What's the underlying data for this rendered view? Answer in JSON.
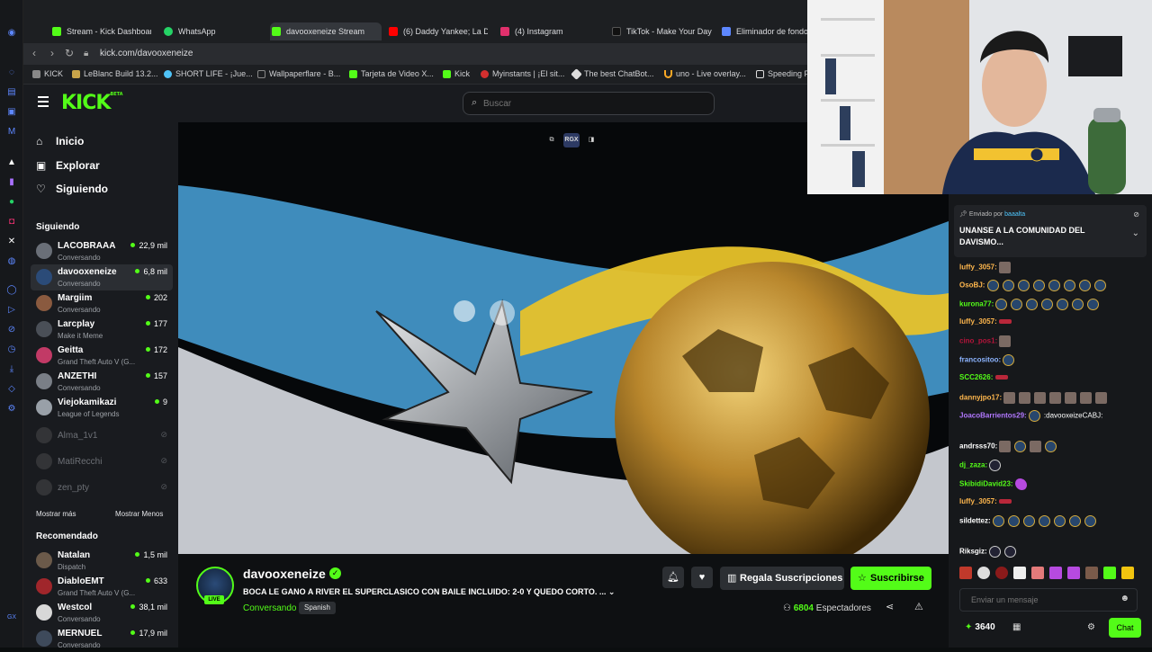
{
  "browser": {
    "tabs": [
      {
        "label": "Stream - Kick Dashboard",
        "color": "#53fc18"
      },
      {
        "label": "WhatsApp",
        "color": "#25d366"
      },
      {
        "label": "davooxeneize Stream",
        "color": "#53fc18",
        "active": true
      },
      {
        "label": "(6) Daddy Yankee; La D",
        "color": "#ff0000"
      },
      {
        "label": "(4) Instagram",
        "color": "#e1306c"
      },
      {
        "label": "TikTok - Make Your Day",
        "color": "#111111"
      },
      {
        "label": "Eliminador de fondo",
        "color": "#5d87ff"
      }
    ],
    "url": "kick.com/davooxeneize",
    "bookmarks": [
      {
        "label": "KICK",
        "color": "#888"
      },
      {
        "label": "LeBlanc Build 13.2...",
        "color": "#c8a44a"
      },
      {
        "label": "SHORT LIFE - ¡Jue...",
        "color": "#4fc3f7"
      },
      {
        "label": "Wallpaperflare - B...",
        "color": "#888"
      },
      {
        "label": "Tarjeta de Video X...",
        "color": "#53fc18"
      },
      {
        "label": "Kick",
        "color": "#53fc18"
      },
      {
        "label": "Myinstants | ¡El sit...",
        "color": "#d32f2f"
      },
      {
        "label": "The best ChatBot...",
        "color": "#ddd"
      },
      {
        "label": "uno - Live overlay...",
        "color": "#f9a825"
      },
      {
        "label": "Speeding F",
        "color": "#ddd"
      }
    ]
  },
  "header": {
    "logo": "KICK",
    "logo_beta": "BETA",
    "search_placeholder": "Buscar"
  },
  "sidebar": {
    "nav": [
      {
        "label": "Inicio",
        "icon": "home-icon"
      },
      {
        "label": "Explorar",
        "icon": "compass-icon"
      },
      {
        "label": "Siguiendo",
        "icon": "heart-icon"
      }
    ],
    "following_title": "Siguiendo",
    "following": [
      {
        "name": "LACOBRAAA",
        "sub": "Conversando",
        "viewers": "22,9 mil"
      },
      {
        "name": "davooxeneize",
        "sub": "Conversando",
        "viewers": "6,8 mil",
        "selected": true
      },
      {
        "name": "Margiim",
        "sub": "Conversando",
        "viewers": "202"
      },
      {
        "name": "Larcplay",
        "sub": "Make it Meme",
        "viewers": "177"
      },
      {
        "name": "Geitta",
        "sub": "Grand Theft Auto V (G...",
        "viewers": "172"
      },
      {
        "name": "ANZETHI",
        "sub": "Conversando",
        "viewers": "157"
      },
      {
        "name": "Viejokamikazi",
        "sub": "League of Legends",
        "viewers": "9"
      }
    ],
    "offline": [
      {
        "name": "Alma_1v1"
      },
      {
        "name": "MatiRecchi"
      },
      {
        "name": "zen_pty"
      }
    ],
    "show_more": "Mostrar más",
    "show_less": "Mostrar Menos",
    "recommended_title": "Recomendado",
    "recommended": [
      {
        "name": "Natalan",
        "sub": "Dispatch",
        "viewers": "1,5 mil"
      },
      {
        "name": "DiabloEMT",
        "sub": "Grand Theft Auto V (G...",
        "viewers": "633"
      },
      {
        "name": "Westcol",
        "sub": "Conversando",
        "viewers": "38,1 mil"
      },
      {
        "name": "MERNUEL",
        "sub": "Conversando",
        "viewers": "17,9 mil"
      }
    ]
  },
  "player": {
    "tools": [
      "RGX"
    ]
  },
  "stream": {
    "name": "davooxeneize",
    "live_badge": "LIVE",
    "title": "BOCA LE GANO A RIVER EL SUPERCLASICO CON BAILE INCLUIDO: 2-0 Y QUEDO CORTO. ...",
    "category": "Conversando",
    "language": "Spanish",
    "gift_label": "Regala Suscripciones",
    "subscribe_label": "Suscribirse",
    "viewer_count": "6804",
    "viewer_label": "Espectadores"
  },
  "chat": {
    "pinned_by_prefix": "Enviado por",
    "pinned_by": "baaalta",
    "pinned_message": "UNANSE A LA COMUNIDAD DEL DAVISMO...",
    "messages": [
      {
        "user": "luffy_3057:",
        "color": "#ffb74d",
        "emotes": [
          "img"
        ]
      },
      {
        "user": "OsoBJ:",
        "color": "#ffb74d",
        "emotes": [
          "b",
          "b",
          "b",
          "b",
          "b",
          "b",
          "b",
          "b"
        ]
      },
      {
        "user": "kurona77:",
        "color": "#53fc18",
        "emotes": [
          "b",
          "b",
          "b",
          "b",
          "b",
          "b",
          "b"
        ]
      },
      {
        "user": "luffy_3057:",
        "color": "#ffb74d",
        "emotes": [
          "red"
        ]
      },
      {
        "user": "cino_pos1:",
        "color": "#b3143a",
        "emotes": [
          "img"
        ]
      },
      {
        "user": "francositoo:",
        "color": "#8cb4ff",
        "emotes": [
          "b"
        ]
      },
      {
        "user": "SCC2626:",
        "color": "#53fc18",
        "emotes": [
          "red"
        ]
      },
      {
        "user": "dannyjpo17:",
        "color": "#ffb74d",
        "emotes": [
          "img",
          "img",
          "img",
          "img",
          "img",
          "img",
          "img"
        ]
      },
      {
        "user": "JoacoBarrientos29:",
        "color": "#b278ff",
        "text": ":davooxeizeCABJ:",
        "emotes": [
          "b"
        ]
      },
      {
        "user": "andrsss70:",
        "color": "#fff",
        "emotes": [
          "img",
          "b",
          "img",
          "b"
        ]
      },
      {
        "user": "dj_zaza:",
        "color": "#53fc18",
        "emotes": [
          "ball"
        ]
      },
      {
        "user": "SkibidiDavid23:",
        "color": "#53fc18",
        "emotes": [
          "purple"
        ]
      },
      {
        "user": "luffy_3057:",
        "color": "#ffb74d",
        "emotes": [
          "red"
        ]
      },
      {
        "user": "sildettez:",
        "color": "#fff",
        "emotes": [
          "b",
          "b",
          "b",
          "b",
          "b",
          "b",
          "b"
        ]
      },
      {
        "user": "Riksgiz:",
        "color": "#fff",
        "emotes": [
          "ball",
          "ball"
        ]
      }
    ],
    "input_placeholder": "Enviar un mensaje",
    "points": "3640",
    "chat_button": "Chat"
  },
  "colors": {
    "accent": "#53fc18",
    "bg": "#0b0e0f",
    "panel": "#191b1f"
  }
}
